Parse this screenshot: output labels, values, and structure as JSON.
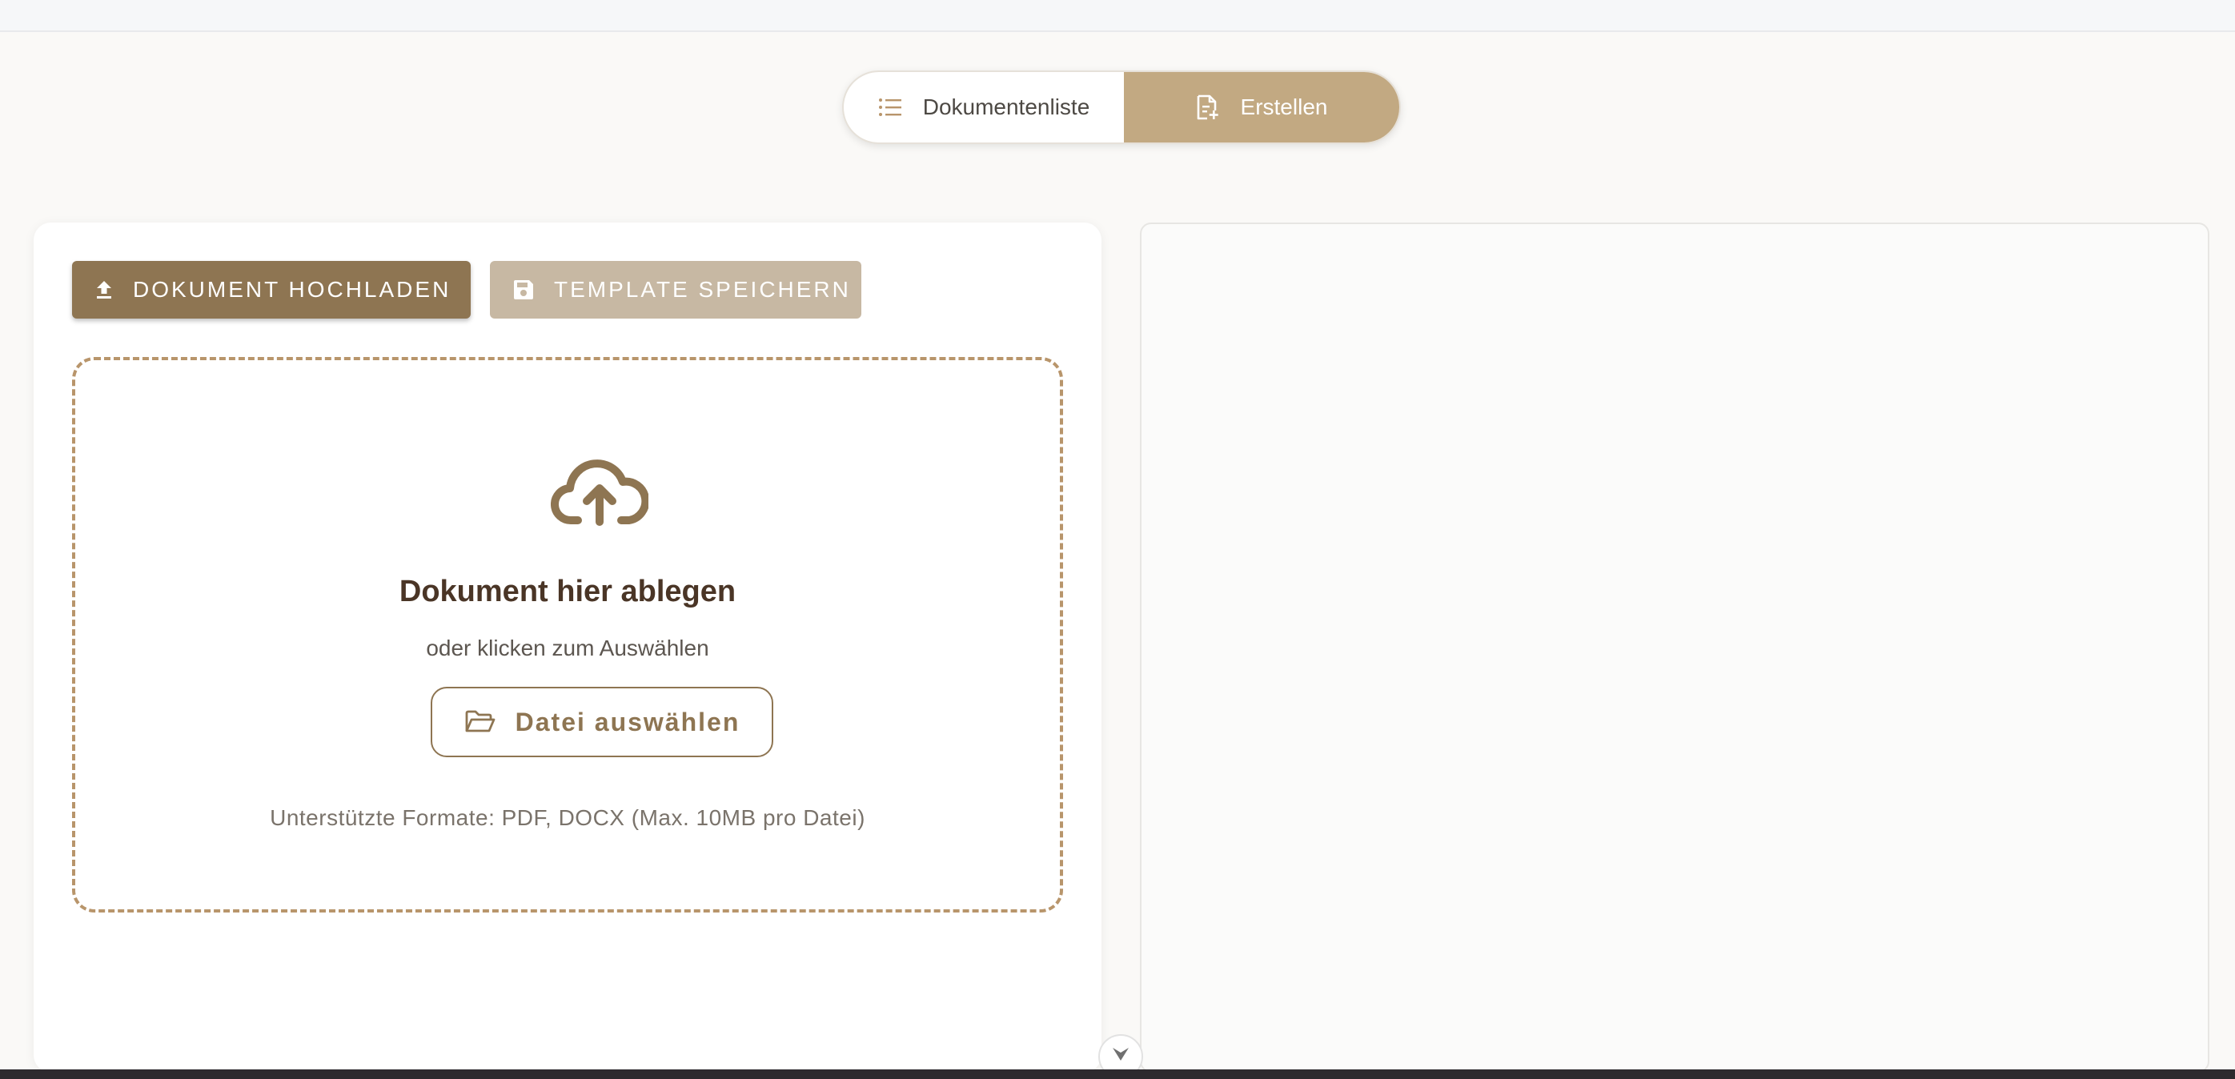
{
  "toggle": {
    "list_label": "Dokumentenliste",
    "create_label": "Erstellen",
    "active": "create"
  },
  "toolbar": {
    "upload_label": "DOKUMENT HOCHLADEN",
    "save_template_label": "TEMPLATE SPEICHERN"
  },
  "dropzone": {
    "title": "Dokument hier ablegen",
    "subtitle": "oder klicken zum Auswählen",
    "choose_file_label": "Datei auswählen",
    "formats": "Unterstützte Formate: PDF, DOCX (Max. 10MB pro Datei)"
  },
  "colors": {
    "accent": "#8e7552",
    "accent_light": "#c2a982",
    "disabled": "#c7b8a3"
  },
  "icons": {
    "list": "list-icon",
    "create": "document-plus-icon",
    "upload": "upload-icon",
    "save": "save-icon",
    "cloud": "cloud-upload-icon",
    "folder": "folder-open-icon",
    "scroll": "chevron-down-icon"
  }
}
